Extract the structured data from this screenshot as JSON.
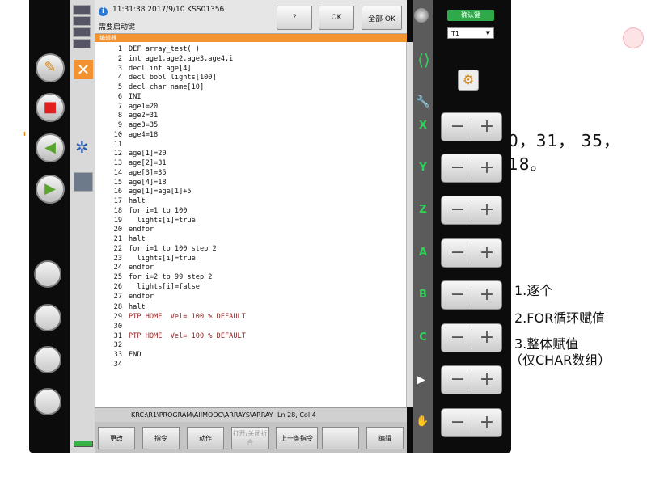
{
  "slide": {
    "numbers_fragment": "0，31， 35，18。",
    "left_fragment": "'",
    "notes": [
      "1.逐个",
      "2.FOR循环赋值",
      "3.整体赋值",
      "（仅CHAR数组）"
    ]
  },
  "message": {
    "timestamp": "11:31:38 2017/9/10 KSS01356",
    "text": "需要启动键",
    "help_label": "?",
    "ok_label": "OK",
    "all_ok_label": "全部 OK"
  },
  "editor": {
    "title": "编辑器",
    "lines": [
      "DEF array_test( )",
      "int age1,age2,age3,age4,i",
      "decl int age[4]",
      "decl bool lights[100]",
      "decl char name[10]",
      "INI",
      "age1=20",
      "age2=31",
      "age3=35",
      "age4=18",
      "",
      "age[1]=20",
      "age[2]=31",
      "age[3]=35",
      "age[4]=18",
      "age[1]=age[1]+5",
      "halt",
      "for i=1 to 100",
      "  lights[i]=true",
      "endfor",
      "halt",
      "for i=1 to 100 step 2",
      "  lights[i]=true",
      "endfor",
      "for i=2 to 99 step 2",
      "  lights[i]=false",
      "endfor",
      "halt",
      "PTP HOME  Vel= 100 % DEFAULT",
      "",
      "PTP HOME  Vel= 100 % DEFAULT",
      "",
      "END",
      ""
    ],
    "highlight_lines": [
      29,
      31
    ],
    "cursor_line": 28,
    "path": "KRC:\\R1\\PROGRAM\\AIIMOOC\\ARRAYS\\ARRAY",
    "position": "Ln 28, Col 4"
  },
  "softkeys": [
    "更改",
    "指令",
    "动作",
    "打开/关闭折合",
    "上一条指令",
    "",
    "编辑"
  ],
  "right_panel": {
    "confirm_label": "确认键",
    "mode": "T1",
    "axes": [
      "X",
      "Y",
      "Z",
      "A",
      "B",
      "C"
    ],
    "minus": "−",
    "plus": "+"
  },
  "icons": {
    "pencil": "✎",
    "stop": "■",
    "back": "◀",
    "forward": "▶",
    "close": "✕",
    "gear": "✲",
    "wrench": "🔧",
    "play": "▶",
    "hand": "✋",
    "robot": "⚙"
  },
  "colors": {
    "accent_orange": "#f29230",
    "axis_green": "#2fd35a",
    "keyword_red": "#8b1d1d",
    "stop_red": "#e02020",
    "nav_green": "#5aa52f"
  }
}
